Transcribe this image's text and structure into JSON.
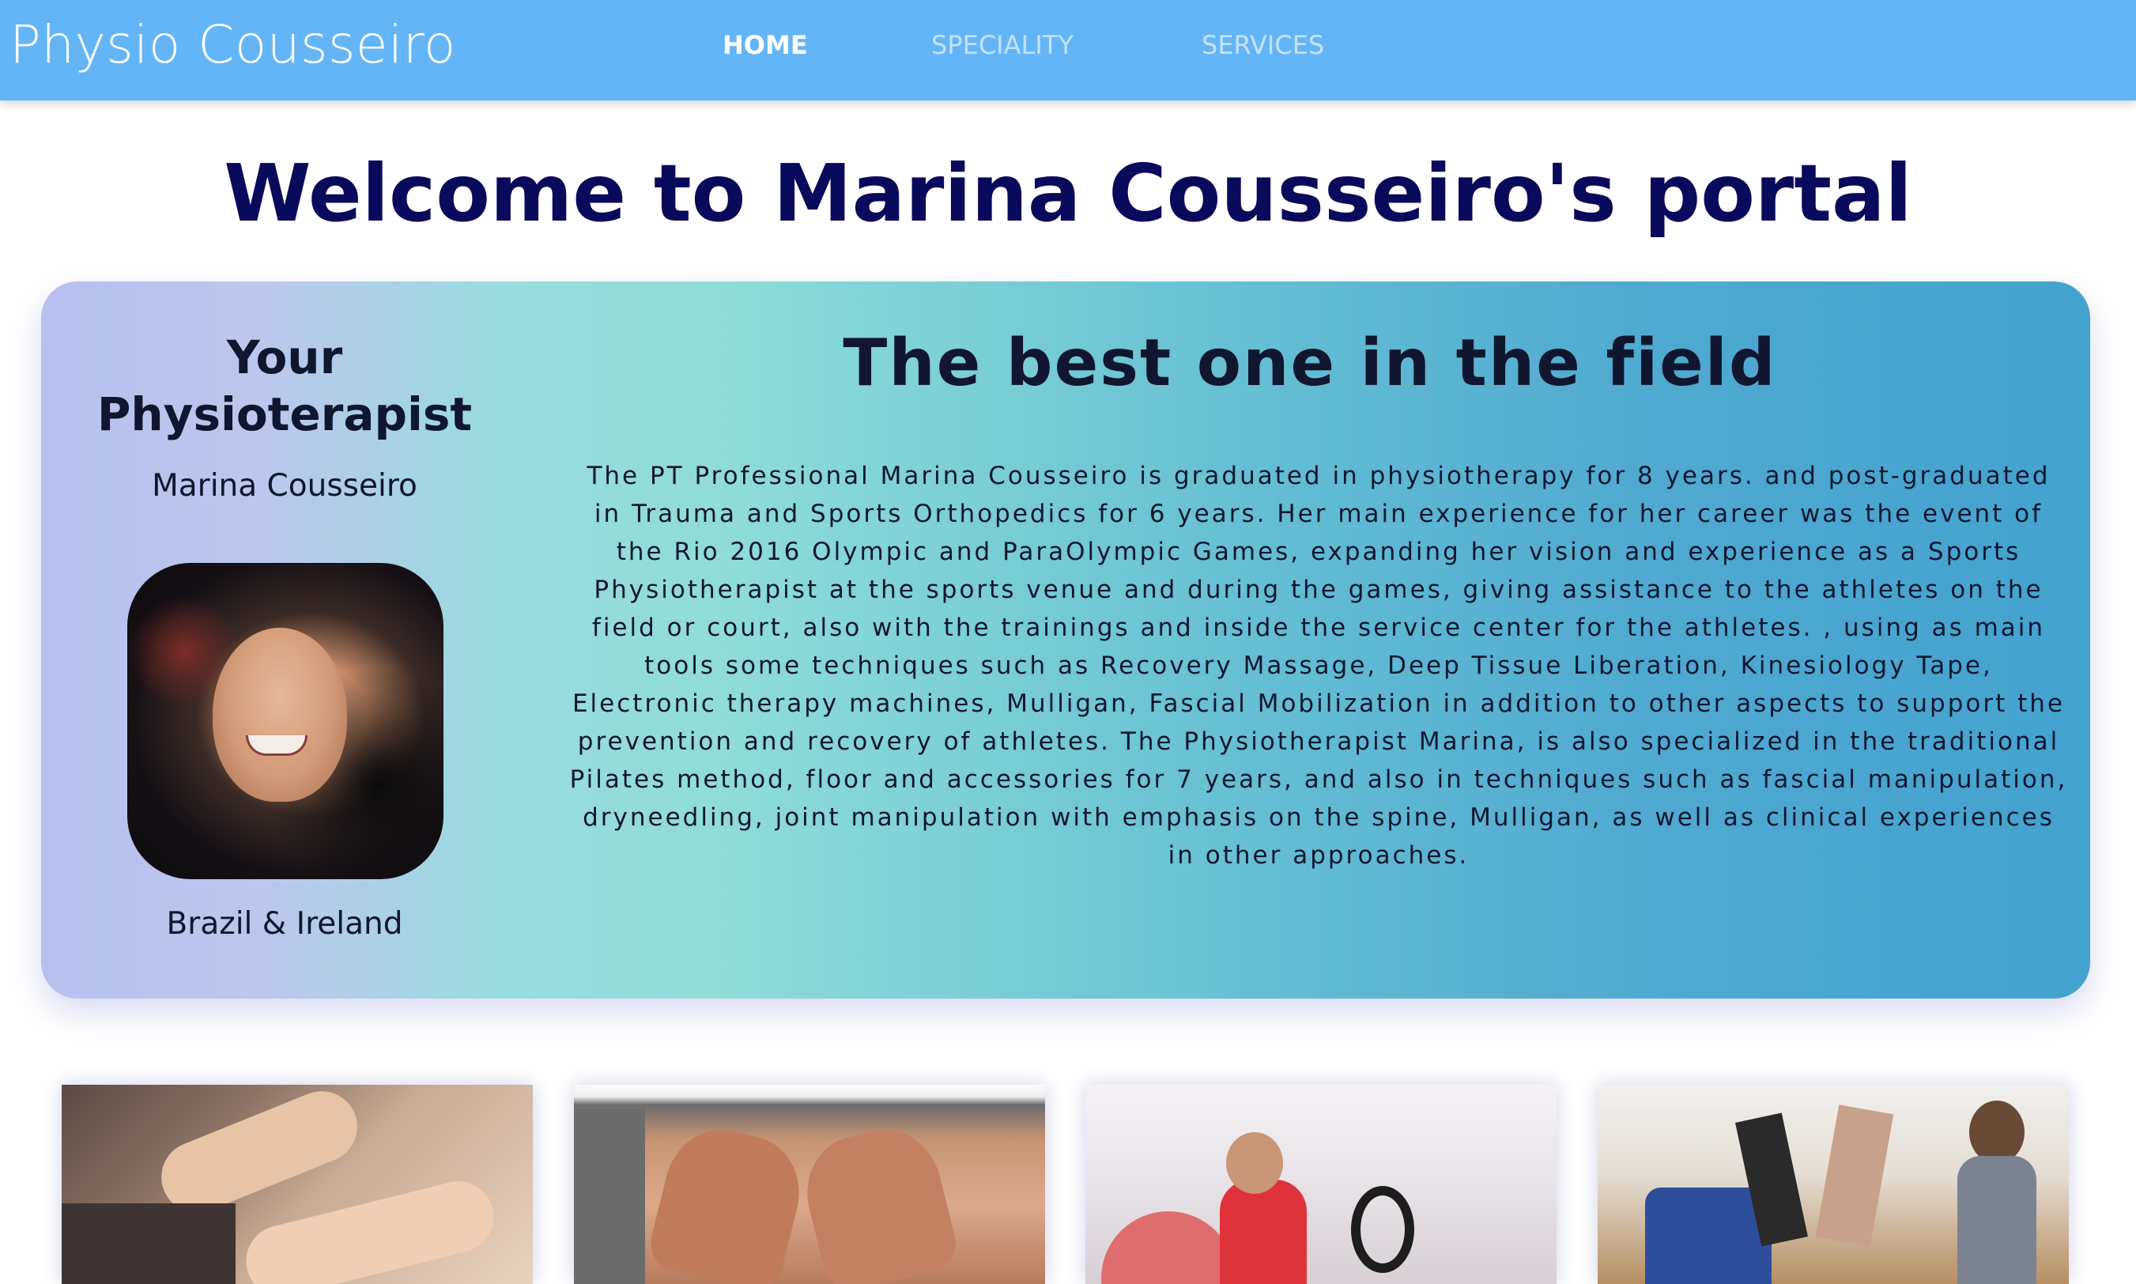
{
  "navbar": {
    "brand": "Physio Cousseiro",
    "links": [
      {
        "label": "HOME",
        "active": true
      },
      {
        "label": "SPECIALITY",
        "active": false
      },
      {
        "label": "SERVICES",
        "active": false
      }
    ],
    "background_color": "#64b5f6"
  },
  "main": {
    "welcome_title": "Welcome to Marina Cousseiro's portal"
  },
  "profile": {
    "heading": "Your Physioterapist",
    "name": "Marina Cousseiro",
    "location": "Brazil & Ireland",
    "photo_icon": "portrait-photo"
  },
  "about": {
    "title": "The best one in the field",
    "bio": "The PT Professional Marina Cousseiro is graduated in physiotherapy for 8 years. and post-graduated in Trauma and Sports Orthopedics for 6 years. Her main experience for her career was the event of the Rio 2016 Olympic and ParaOlympic Games, expanding her vision and experience as a Sports Physiotherapist at the sports venue and during the games, giving assistance to the athletes on the field or court, also with the trainings and inside the service center for the athletes. , using as main tools some techniques such as Recovery Massage, Deep Tissue Liberation, Kinesiology Tape, Electronic therapy machines, Mulligan, Fascial Mobilization in addition to other aspects to support the prevention and recovery of athletes. The Physiotherapist Marina, is also specialized in the traditional Pilates method, floor and accessories for 7 years, and also in techniques such as fascial manipulation, dryneedling, joint manipulation with emphasis on the spine, Mulligan, as well as clinical experiences in other approaches."
  },
  "colors": {
    "title_navy": "#0a0a5c",
    "text_dark": "#10162f",
    "hero_gradient": [
      "#b7c0ef",
      "#8fddd6",
      "#43a2cf"
    ]
  },
  "cards": [
    {
      "image": "dry-needling-photo"
    },
    {
      "image": "back-massage-photo"
    },
    {
      "image": "pilates-ring-photo"
    },
    {
      "image": "pilates-studio-photo"
    }
  ]
}
